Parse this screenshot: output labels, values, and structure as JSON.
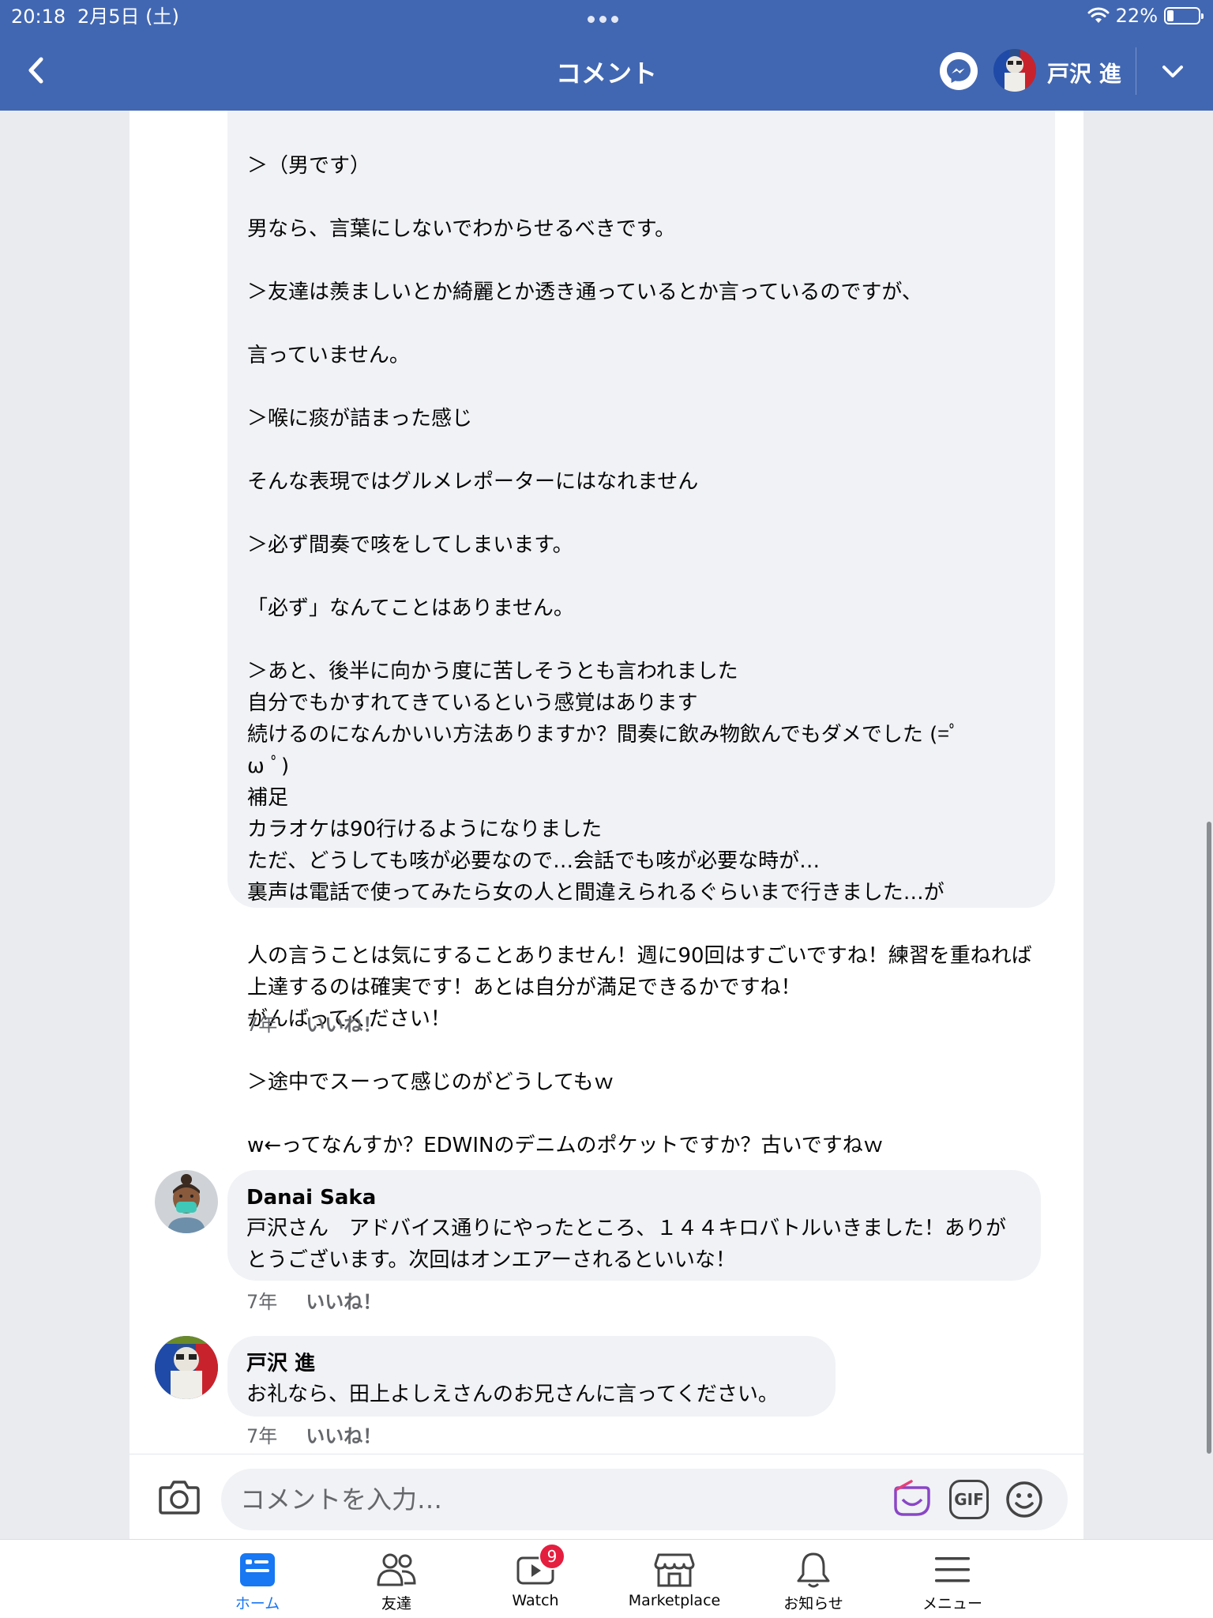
{
  "status_bar": {
    "time": "20:18",
    "date": "2月5日 (土)",
    "battery": "22%"
  },
  "nav": {
    "title": "コメント",
    "profile_name": "戸沢 進"
  },
  "comments": [
    {
      "text": "＞（男です）\n\n男なら、言葉にしないでわからせるべきです。\n\n＞友達は羨ましいとか綺麗とか透き通っているとか言っているのですが、\n\n言っていません。\n\n＞喉に痰が詰まった感じ\n\nそんな表現ではグルメレポーターにはなれません\n\n＞必ず間奏で咳をしてしまいます。\n\n「必ず」なんてことはありません。\n\n＞あと、後半に向かう度に苦しそうとも言われました\n自分でもかすれてきているという感覚はあります\n続けるのになんかいい方法ありますか？間奏に飲み物飲んでもダメでした (=ﾟ\nω ﾟ)\n補足\nカラオケは90行けるようになりました\nただ、どうしても咳が必要なので…会話でも咳が必要な時が…\n裏声は電話で使ってみたら女の人と間違えられるぐらいまで行きました…が\n\n人の言うことは気にすることありません！週に90回はすごいですね！練習を重ねれば上達するのは確実です！あとは自分が満足できるかですね！\nがんばってください！\n\n＞途中でスーって感じのがどうしてもｗ\n\nw←ってなんすか？EDWINのデニムのポケットですか？古いですねｗ",
      "time": "7年",
      "like": "いいね！"
    },
    {
      "author": "Danai Saka",
      "text": "戸沢さん　アドバイス通りにやったところ、１４４キロバトルいきました！ありがとうございます。次回はオンエアーされるといいな！",
      "time": "7年",
      "like": "いいね！"
    },
    {
      "author": "戸沢 進",
      "text": "お礼なら、田上よしえさんのお兄さんに言ってください。",
      "time": "7年",
      "like": "いいね！"
    }
  ],
  "composer": {
    "placeholder": "コメントを入力…",
    "gif_label": "GIF"
  },
  "tabs": [
    {
      "label": "ホーム",
      "icon": "home-feed-icon"
    },
    {
      "label": "友達",
      "icon": "friends-icon"
    },
    {
      "label": "Watch",
      "icon": "watch-icon",
      "badge": "9"
    },
    {
      "label": "Marketplace",
      "icon": "marketplace-icon"
    },
    {
      "label": "お知らせ",
      "icon": "bell-icon"
    },
    {
      "label": "メニュー",
      "icon": "menu-icon"
    }
  ],
  "colors": {
    "header": "#4267b2",
    "bubble": "#f0f2f5",
    "active_tab": "#1877f2",
    "badge": "#e41e3f"
  }
}
